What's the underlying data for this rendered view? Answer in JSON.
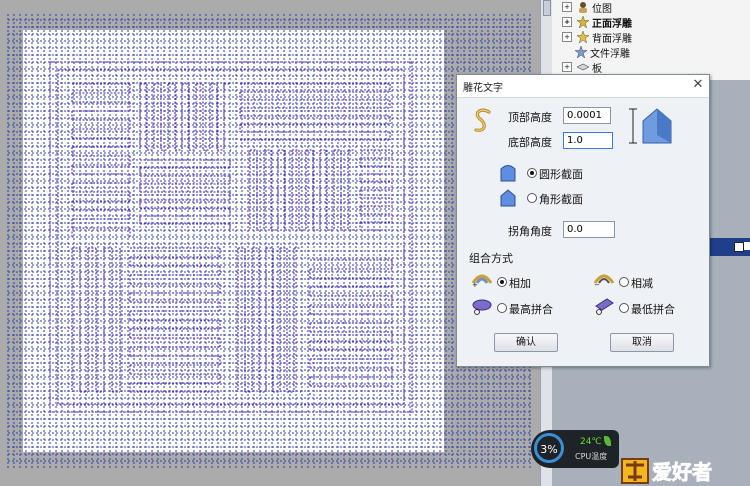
{
  "layers": {
    "items": [
      {
        "label": "位图",
        "expand": "+"
      },
      {
        "label": "正面浮雕",
        "expand": "+"
      },
      {
        "label": "背面浮雕",
        "expand": "+"
      },
      {
        "label": "文件浮雕",
        "expand": ""
      },
      {
        "label": "板",
        "expand": "+"
      }
    ]
  },
  "dialog": {
    "title": "雕花文字",
    "close_glyph": "✕",
    "top_height_label": "顶部高度",
    "top_height_value": "0.0001",
    "bottom_height_label": "底部高度",
    "bottom_height_value": "1.0",
    "round_section_label": "圆形截面",
    "angle_section_label": "角形截面",
    "corner_angle_label": "拐角角度",
    "corner_angle_value": "0.0",
    "combine_label": "组合方式",
    "add_label": "相加",
    "subtract_label": "相减",
    "highest_merge_label": "最高拼合",
    "lowest_merge_label": "最低拼合",
    "ok_label": "确认",
    "cancel_label": "取消",
    "section_selected": "round",
    "combine_selected": "add"
  },
  "system_widget": {
    "cpu_percent": "3%",
    "temperature": "24℃",
    "caption": "CPU温度"
  },
  "logo_text": "爱好者",
  "colors": {
    "accent_blue": "#3a7bd5",
    "maze_purple": "#6b3fc4",
    "grid_blue": "#2b3fa8",
    "selection_blue": "#1f3f8a"
  }
}
